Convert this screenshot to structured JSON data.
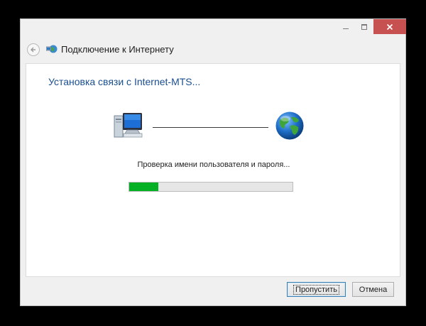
{
  "window": {
    "title": "Подключение к Интернету",
    "caption_buttons": {
      "minimize": "minimize-icon",
      "maximize": "maximize-icon",
      "close": "close-icon"
    }
  },
  "content": {
    "heading": "Установка связи с Internet-MTS...",
    "status": "Проверка имени пользователя и пароля...",
    "progress": 0.18,
    "accent_color": "#1a4f8f",
    "progress_color": "#06b025"
  },
  "buttons": {
    "skip": "Пропустить",
    "cancel": "Отмена"
  },
  "icons": {
    "back": "back-arrow-icon",
    "network": "network-connection-icon",
    "computer": "computer-icon",
    "globe": "globe-icon"
  }
}
